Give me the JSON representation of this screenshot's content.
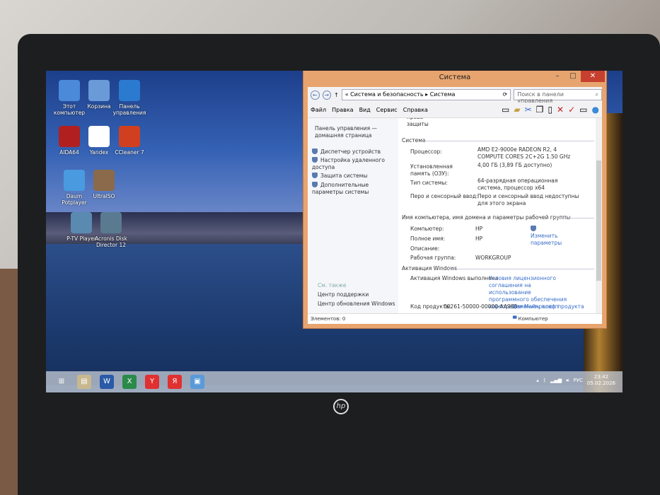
{
  "desktop": {
    "icons": [
      {
        "label": "Этот компьютер",
        "color": "#4a8ad8"
      },
      {
        "label": "Корзина",
        "color": "#6a9ad8"
      },
      {
        "label": "Панель управления",
        "color": "#2a7ad0"
      },
      {
        "label": "AIDA64",
        "color": "#b02020"
      },
      {
        "label": "Yandex",
        "color": "#ffffff"
      },
      {
        "label": "CCleaner 7",
        "color": "#d04020"
      },
      {
        "label": "Daum Potplayer",
        "color": "#4a9ae0"
      },
      {
        "label": "UltraISO",
        "color": "#8a6a4a"
      },
      {
        "label": "P-TV Player",
        "color": "#5a8ab0"
      },
      {
        "label": "Acronis Disk Director 12",
        "color": "#5a7a90"
      }
    ]
  },
  "window": {
    "title": "Система",
    "minimize": "–",
    "maximize": "□",
    "close": "✕",
    "back": "←",
    "forward": "→",
    "up": "↑",
    "breadcrumb": "« Система и безопасность ▸ Система",
    "search_placeholder": "Поиск в панели управления",
    "menu": [
      "Файл",
      "Правка",
      "Вид",
      "Сервис",
      "Справка"
    ],
    "left": {
      "home": "Панель управления — домашняя страница",
      "links": [
        "Диспетчер устройств",
        "Настройка удаленного доступа",
        "Защита системы",
        "Дополнительные параметры системы"
      ],
      "see_also": "См. также",
      "see_links": [
        "Центр поддержки",
        "Центр обновления Windows"
      ]
    },
    "cut_text": "права защиты",
    "system": {
      "header": "Система",
      "processor_label": "Процессор:",
      "processor": "AMD E2-9000e RADEON R2, 4 COMPUTE CORES 2C+2G    1.50 GHz",
      "ram_label": "Установленная память (ОЗУ):",
      "ram": "4,00 ГБ (3,89 ГБ доступно)",
      "type_label": "Тип системы:",
      "type": "64-разрядная операционная система, процессор x64",
      "pen_label": "Перо и сенсорный ввод:",
      "pen": "Перо и сенсорный ввод недоступны для этого экрана"
    },
    "computer": {
      "header": "Имя компьютера, имя домена и параметры рабочей группы",
      "name_label": "Компьютер:",
      "name": "HP",
      "full_label": "Полное имя:",
      "full": "HP",
      "desc_label": "Описание:",
      "group_label": "Рабочая группа:",
      "group": "WORKGROUP",
      "change": "Изменить параметры"
    },
    "activation": {
      "header": "Активация Windows",
      "status": "Активация Windows выполнена",
      "license": "Условия лицензионного соглашения на использование программного обеспечения корпорации Майкрософт",
      "key_label": "Код продукта:",
      "key": "00261-50000-00000-AA989",
      "change_key": "Изменить ключ продукта"
    },
    "status_items": "Элементов: 0",
    "status_location": "Компьютер"
  },
  "taskbar": {
    "apps": [
      {
        "label": "⊞",
        "color": "transparent"
      },
      {
        "label": "▤",
        "color": "#c8b890"
      },
      {
        "label": "W",
        "color": "#2a5aa8"
      },
      {
        "label": "X",
        "color": "#2a8a4a"
      },
      {
        "label": "Y",
        "color": "#e03030"
      },
      {
        "label": "Я",
        "color": "#e03030"
      },
      {
        "label": "▣",
        "color": "#5a9ad8"
      }
    ],
    "lang": "РУС",
    "time": "23:42",
    "date": "05.02.2026"
  },
  "brand": "hp"
}
